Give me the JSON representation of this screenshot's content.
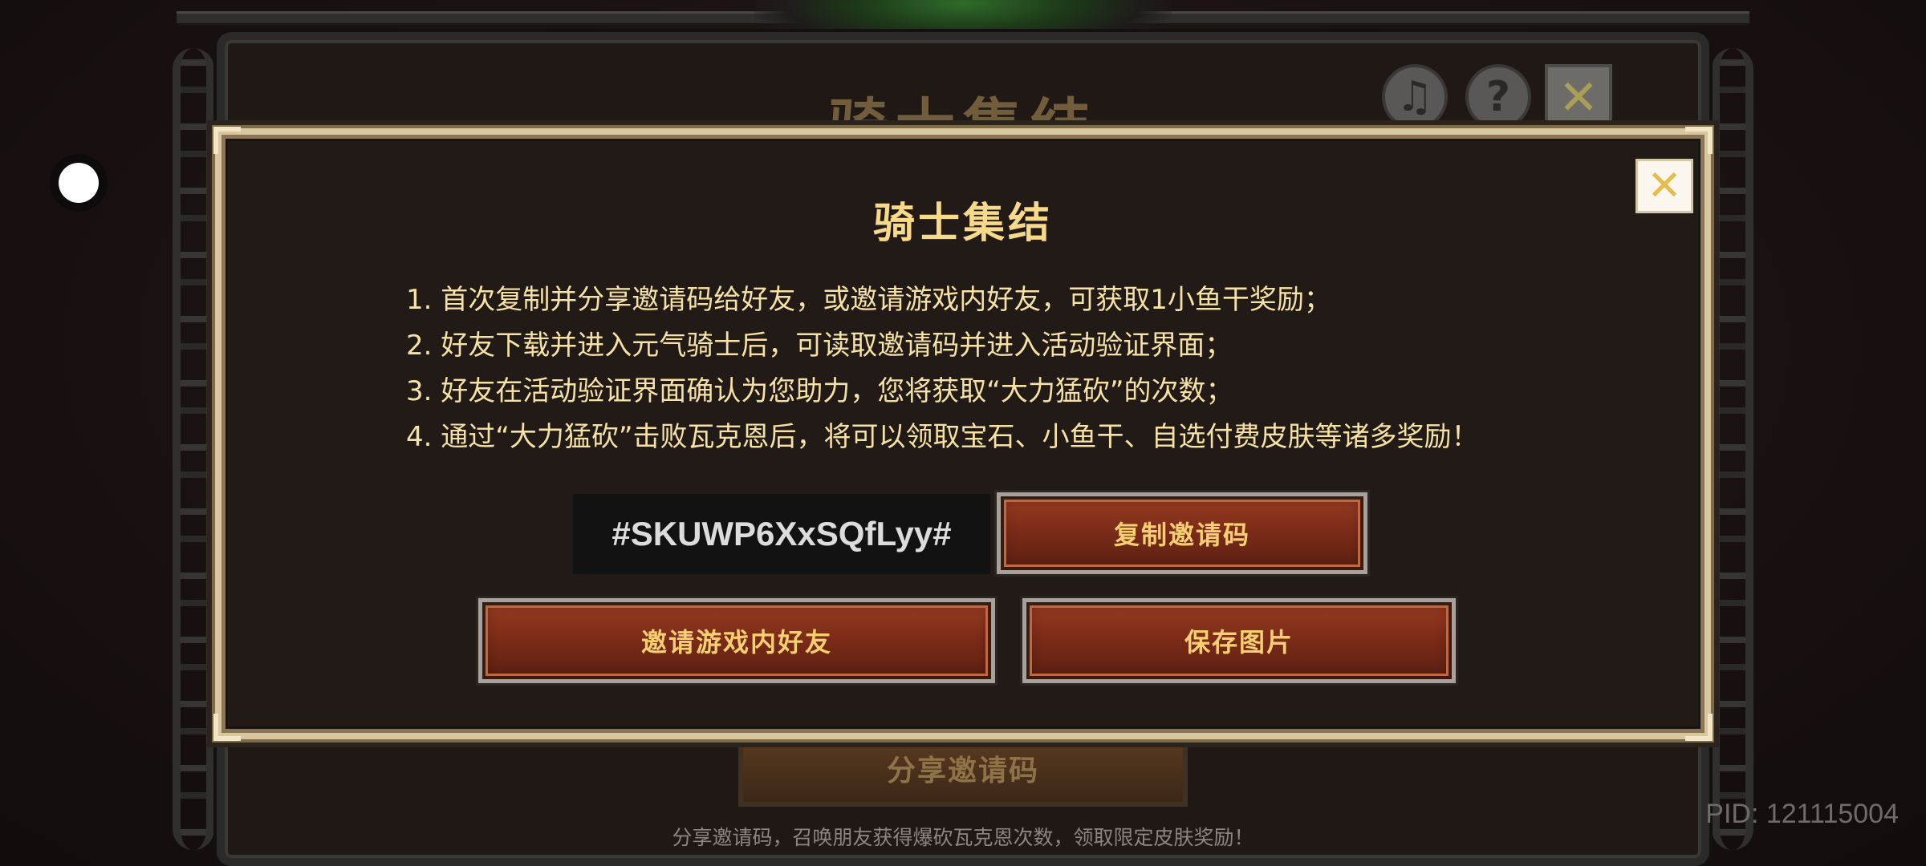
{
  "background": {
    "title": "骑士集结",
    "share_button_label": "分享邀请码",
    "footer_text": "分享邀请码，召唤朋友获得爆砍瓦克恩次数，领取限定皮肤奖励！",
    "pid_text": "PID: 121115004",
    "music_icon_glyph": "♫",
    "help_icon_glyph": "?",
    "close_icon_glyph": "✕"
  },
  "modal": {
    "title": "骑士集结",
    "close_glyph": "✕",
    "rules": [
      "1. 首次复制并分享邀请码给好友，或邀请游戏内好友，可获取1小鱼干奖励；",
      "2. 好友下载并进入元气骑士后，可读取邀请码并进入活动验证界面；",
      "3. 好友在活动验证界面确认为您助力，您将获取“大力猛砍”的次数；",
      "4. 通过“大力猛砍”击败瓦克恩后，将可以领取宝石、小鱼干、自选付费皮肤等诸多奖励！"
    ],
    "invite_code": "#SKUWP6XxSQfLyy#",
    "copy_button_label": "复制邀请码",
    "invite_friends_button_label": "邀请游戏内好友",
    "save_image_button_label": "保存图片"
  },
  "colors": {
    "modal_text": "#f7e2a6",
    "title": "#f7d98a",
    "button_label": "#f6cf70",
    "button_fill": "#7d2c18"
  }
}
